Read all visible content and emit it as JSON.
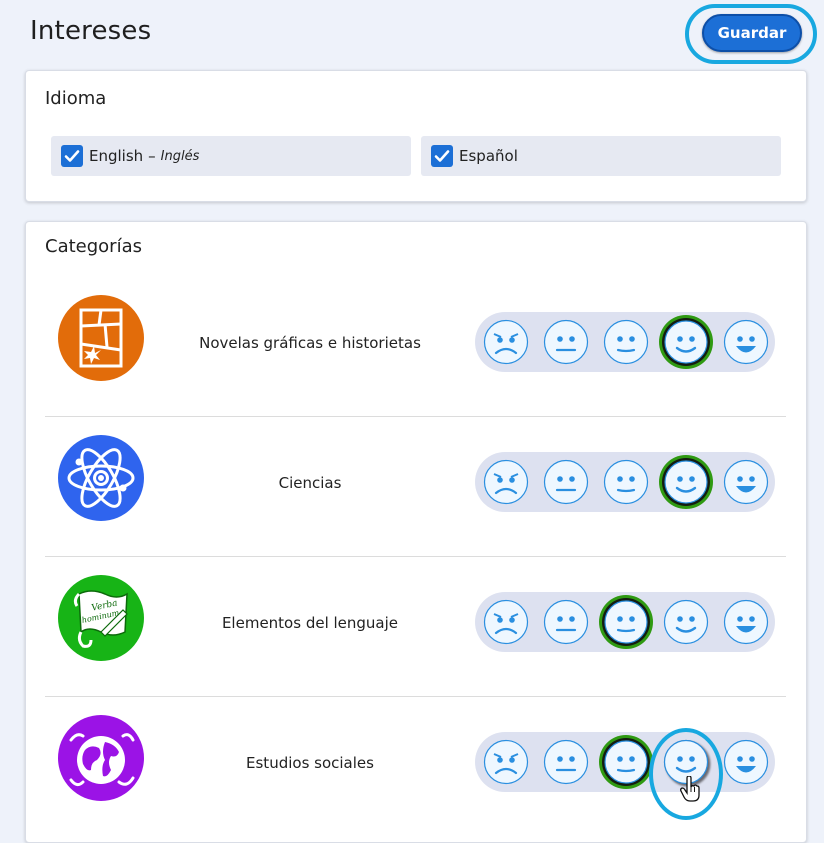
{
  "header": {
    "title": "Intereses",
    "save_label": "Guardar"
  },
  "language": {
    "title": "Idioma",
    "options": [
      {
        "label": "English",
        "separator": "–",
        "native": "Inglés",
        "checked": true
      },
      {
        "label": "Español",
        "checked": true
      }
    ]
  },
  "categories": {
    "title": "Categorías",
    "items": [
      {
        "name": "Novelas gráficas e historietas",
        "icon": "comic-book-icon",
        "icon_color": "#e26c0a",
        "rating": 4,
        "max_rating": 5
      },
      {
        "name": "Ciencias",
        "icon": "atom-icon",
        "icon_color": "#2f64ee",
        "rating": 4,
        "max_rating": 5
      },
      {
        "name": "Elementos del lenguaje",
        "icon": "scroll-quill-icon",
        "icon_color": "#17b416",
        "icon_text": [
          "Verba",
          "hominum"
        ],
        "rating": 3,
        "max_rating": 5
      },
      {
        "name": "Estudios sociales",
        "icon": "globe-icon",
        "icon_color": "#9b13e6",
        "rating": 3,
        "max_rating": 5,
        "hovered_rating": 4
      }
    ]
  },
  "rating_faces": [
    "sad-face-icon",
    "neutral-face-icon",
    "slight-smile-face-icon",
    "smile-face-icon",
    "big-smile-face-icon"
  ],
  "colors": {
    "accent": "#1c6fd6",
    "highlight_ring": "#18a8e0",
    "selected_ring": "#2f9a12",
    "face_fill": "#eef7ff",
    "face_stroke": "#2a8fe0",
    "rating_track": "#dde1f0"
  }
}
